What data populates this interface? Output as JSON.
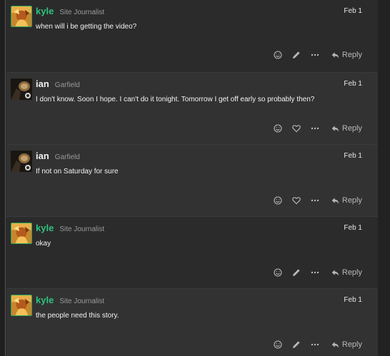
{
  "reply_label": "Reply",
  "colors": {
    "kyle_name": "#2ec27e",
    "ian_name": "#f0f0f0",
    "background": "#222222"
  },
  "posts": [
    {
      "username": "kyle",
      "user_title": "Site Journalist",
      "date": "Feb 1",
      "text": "when will i be getting the video?",
      "actions": [
        "smile-icon",
        "pencil-icon",
        "more-icon"
      ]
    },
    {
      "username": "ian",
      "user_title": "Garfield",
      "date": "Feb 1",
      "text": "I don't know. Soon I hope. I can't do it tonight. Tomorrow I get off early so probably then?",
      "actions": [
        "smile-icon",
        "heart-icon",
        "more-icon"
      ]
    },
    {
      "username": "ian",
      "user_title": "Garfield",
      "date": "Feb 1",
      "text": "If not on Saturday for sure",
      "actions": [
        "smile-icon",
        "heart-icon",
        "more-icon"
      ]
    },
    {
      "username": "kyle",
      "user_title": "Site Journalist",
      "date": "Feb 1",
      "text": "okay",
      "actions": [
        "smile-icon",
        "pencil-icon",
        "more-icon"
      ]
    },
    {
      "username": "kyle",
      "user_title": "Site Journalist",
      "date": "Feb 1",
      "text": "the people need this story.",
      "actions": [
        "smile-icon",
        "pencil-icon",
        "more-icon"
      ]
    }
  ]
}
